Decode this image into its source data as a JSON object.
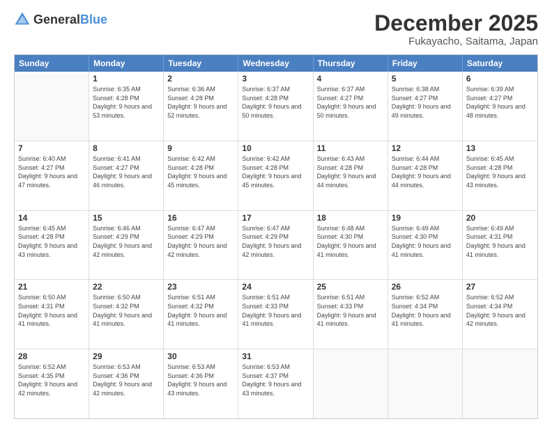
{
  "header": {
    "logo_general": "General",
    "logo_blue": "Blue",
    "title": "December 2025",
    "subtitle": "Fukayacho, Saitama, Japan"
  },
  "calendar": {
    "days_of_week": [
      "Sunday",
      "Monday",
      "Tuesday",
      "Wednesday",
      "Thursday",
      "Friday",
      "Saturday"
    ],
    "weeks": [
      [
        {
          "day": "",
          "sunrise": "",
          "sunset": "",
          "daylight": "",
          "empty": true
        },
        {
          "day": "1",
          "sunrise": "Sunrise: 6:35 AM",
          "sunset": "Sunset: 4:28 PM",
          "daylight": "Daylight: 9 hours and 53 minutes.",
          "empty": false
        },
        {
          "day": "2",
          "sunrise": "Sunrise: 6:36 AM",
          "sunset": "Sunset: 4:28 PM",
          "daylight": "Daylight: 9 hours and 52 minutes.",
          "empty": false
        },
        {
          "day": "3",
          "sunrise": "Sunrise: 6:37 AM",
          "sunset": "Sunset: 4:28 PM",
          "daylight": "Daylight: 9 hours and 50 minutes.",
          "empty": false
        },
        {
          "day": "4",
          "sunrise": "Sunrise: 6:37 AM",
          "sunset": "Sunset: 4:27 PM",
          "daylight": "Daylight: 9 hours and 50 minutes.",
          "empty": false
        },
        {
          "day": "5",
          "sunrise": "Sunrise: 6:38 AM",
          "sunset": "Sunset: 4:27 PM",
          "daylight": "Daylight: 9 hours and 49 minutes.",
          "empty": false
        },
        {
          "day": "6",
          "sunrise": "Sunrise: 6:39 AM",
          "sunset": "Sunset: 4:27 PM",
          "daylight": "Daylight: 9 hours and 48 minutes.",
          "empty": false
        }
      ],
      [
        {
          "day": "7",
          "sunrise": "Sunrise: 6:40 AM",
          "sunset": "Sunset: 4:27 PM",
          "daylight": "Daylight: 9 hours and 47 minutes.",
          "empty": false
        },
        {
          "day": "8",
          "sunrise": "Sunrise: 6:41 AM",
          "sunset": "Sunset: 4:27 PM",
          "daylight": "Daylight: 9 hours and 46 minutes.",
          "empty": false
        },
        {
          "day": "9",
          "sunrise": "Sunrise: 6:42 AM",
          "sunset": "Sunset: 4:28 PM",
          "daylight": "Daylight: 9 hours and 45 minutes.",
          "empty": false
        },
        {
          "day": "10",
          "sunrise": "Sunrise: 6:42 AM",
          "sunset": "Sunset: 4:28 PM",
          "daylight": "Daylight: 9 hours and 45 minutes.",
          "empty": false
        },
        {
          "day": "11",
          "sunrise": "Sunrise: 6:43 AM",
          "sunset": "Sunset: 4:28 PM",
          "daylight": "Daylight: 9 hours and 44 minutes.",
          "empty": false
        },
        {
          "day": "12",
          "sunrise": "Sunrise: 6:44 AM",
          "sunset": "Sunset: 4:28 PM",
          "daylight": "Daylight: 9 hours and 44 minutes.",
          "empty": false
        },
        {
          "day": "13",
          "sunrise": "Sunrise: 6:45 AM",
          "sunset": "Sunset: 4:28 PM",
          "daylight": "Daylight: 9 hours and 43 minutes.",
          "empty": false
        }
      ],
      [
        {
          "day": "14",
          "sunrise": "Sunrise: 6:45 AM",
          "sunset": "Sunset: 4:28 PM",
          "daylight": "Daylight: 9 hours and 43 minutes.",
          "empty": false
        },
        {
          "day": "15",
          "sunrise": "Sunrise: 6:46 AM",
          "sunset": "Sunset: 4:29 PM",
          "daylight": "Daylight: 9 hours and 42 minutes.",
          "empty": false
        },
        {
          "day": "16",
          "sunrise": "Sunrise: 6:47 AM",
          "sunset": "Sunset: 4:29 PM",
          "daylight": "Daylight: 9 hours and 42 minutes.",
          "empty": false
        },
        {
          "day": "17",
          "sunrise": "Sunrise: 6:47 AM",
          "sunset": "Sunset: 4:29 PM",
          "daylight": "Daylight: 9 hours and 42 minutes.",
          "empty": false
        },
        {
          "day": "18",
          "sunrise": "Sunrise: 6:48 AM",
          "sunset": "Sunset: 4:30 PM",
          "daylight": "Daylight: 9 hours and 41 minutes.",
          "empty": false
        },
        {
          "day": "19",
          "sunrise": "Sunrise: 6:49 AM",
          "sunset": "Sunset: 4:30 PM",
          "daylight": "Daylight: 9 hours and 41 minutes.",
          "empty": false
        },
        {
          "day": "20",
          "sunrise": "Sunrise: 6:49 AM",
          "sunset": "Sunset: 4:31 PM",
          "daylight": "Daylight: 9 hours and 41 minutes.",
          "empty": false
        }
      ],
      [
        {
          "day": "21",
          "sunrise": "Sunrise: 6:50 AM",
          "sunset": "Sunset: 4:31 PM",
          "daylight": "Daylight: 9 hours and 41 minutes.",
          "empty": false
        },
        {
          "day": "22",
          "sunrise": "Sunrise: 6:50 AM",
          "sunset": "Sunset: 4:32 PM",
          "daylight": "Daylight: 9 hours and 41 minutes.",
          "empty": false
        },
        {
          "day": "23",
          "sunrise": "Sunrise: 6:51 AM",
          "sunset": "Sunset: 4:32 PM",
          "daylight": "Daylight: 9 hours and 41 minutes.",
          "empty": false
        },
        {
          "day": "24",
          "sunrise": "Sunrise: 6:51 AM",
          "sunset": "Sunset: 4:33 PM",
          "daylight": "Daylight: 9 hours and 41 minutes.",
          "empty": false
        },
        {
          "day": "25",
          "sunrise": "Sunrise: 6:51 AM",
          "sunset": "Sunset: 4:33 PM",
          "daylight": "Daylight: 9 hours and 41 minutes.",
          "empty": false
        },
        {
          "day": "26",
          "sunrise": "Sunrise: 6:52 AM",
          "sunset": "Sunset: 4:34 PM",
          "daylight": "Daylight: 9 hours and 41 minutes.",
          "empty": false
        },
        {
          "day": "27",
          "sunrise": "Sunrise: 6:52 AM",
          "sunset": "Sunset: 4:34 PM",
          "daylight": "Daylight: 9 hours and 42 minutes.",
          "empty": false
        }
      ],
      [
        {
          "day": "28",
          "sunrise": "Sunrise: 6:52 AM",
          "sunset": "Sunset: 4:35 PM",
          "daylight": "Daylight: 9 hours and 42 minutes.",
          "empty": false
        },
        {
          "day": "29",
          "sunrise": "Sunrise: 6:53 AM",
          "sunset": "Sunset: 4:36 PM",
          "daylight": "Daylight: 9 hours and 42 minutes.",
          "empty": false
        },
        {
          "day": "30",
          "sunrise": "Sunrise: 6:53 AM",
          "sunset": "Sunset: 4:36 PM",
          "daylight": "Daylight: 9 hours and 43 minutes.",
          "empty": false
        },
        {
          "day": "31",
          "sunrise": "Sunrise: 6:53 AM",
          "sunset": "Sunset: 4:37 PM",
          "daylight": "Daylight: 9 hours and 43 minutes.",
          "empty": false
        },
        {
          "day": "",
          "sunrise": "",
          "sunset": "",
          "daylight": "",
          "empty": true
        },
        {
          "day": "",
          "sunrise": "",
          "sunset": "",
          "daylight": "",
          "empty": true
        },
        {
          "day": "",
          "sunrise": "",
          "sunset": "",
          "daylight": "",
          "empty": true
        }
      ]
    ]
  }
}
